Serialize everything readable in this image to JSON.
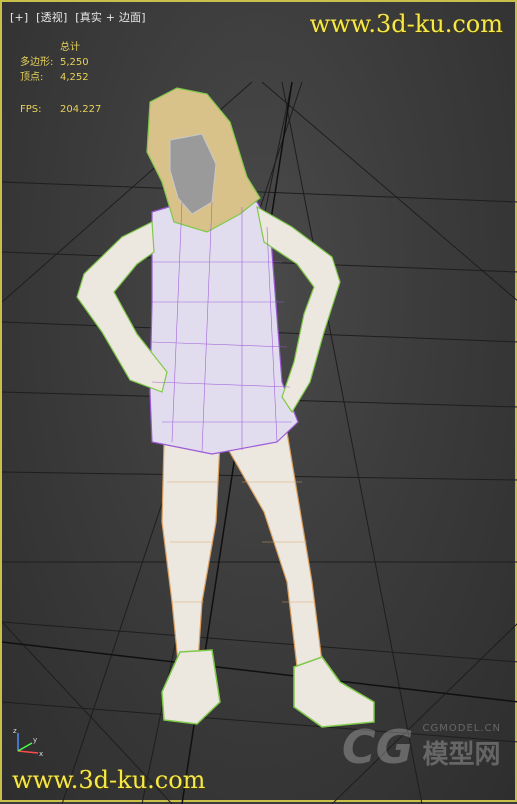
{
  "viewport": {
    "labels": [
      "[+]",
      "[透视]",
      "[真实 + 边面]"
    ],
    "stats": {
      "total_label": "总计",
      "polygons_label": "多边形:",
      "polygons_value": "5,250",
      "vertices_label": "顶点:",
      "vertices_value": "4,252",
      "fps_label": "FPS:",
      "fps_value": "204.227"
    },
    "axis_labels": {
      "x": "x",
      "y": "y",
      "z": "z"
    }
  },
  "watermarks": {
    "top": "www.3d-ku.com",
    "bottom": "www.3d-ku.com",
    "logo_mark": "CG",
    "logo_small": "CGMODEL.CN",
    "logo_big": "模型网"
  },
  "colors": {
    "border": "#c9c04a",
    "stats_text": "#e6d15a",
    "watermark": "#f5e94a",
    "wire_body": "#d9a060",
    "wire_dress": "#9b59d6",
    "wire_green": "#7fc94a"
  }
}
